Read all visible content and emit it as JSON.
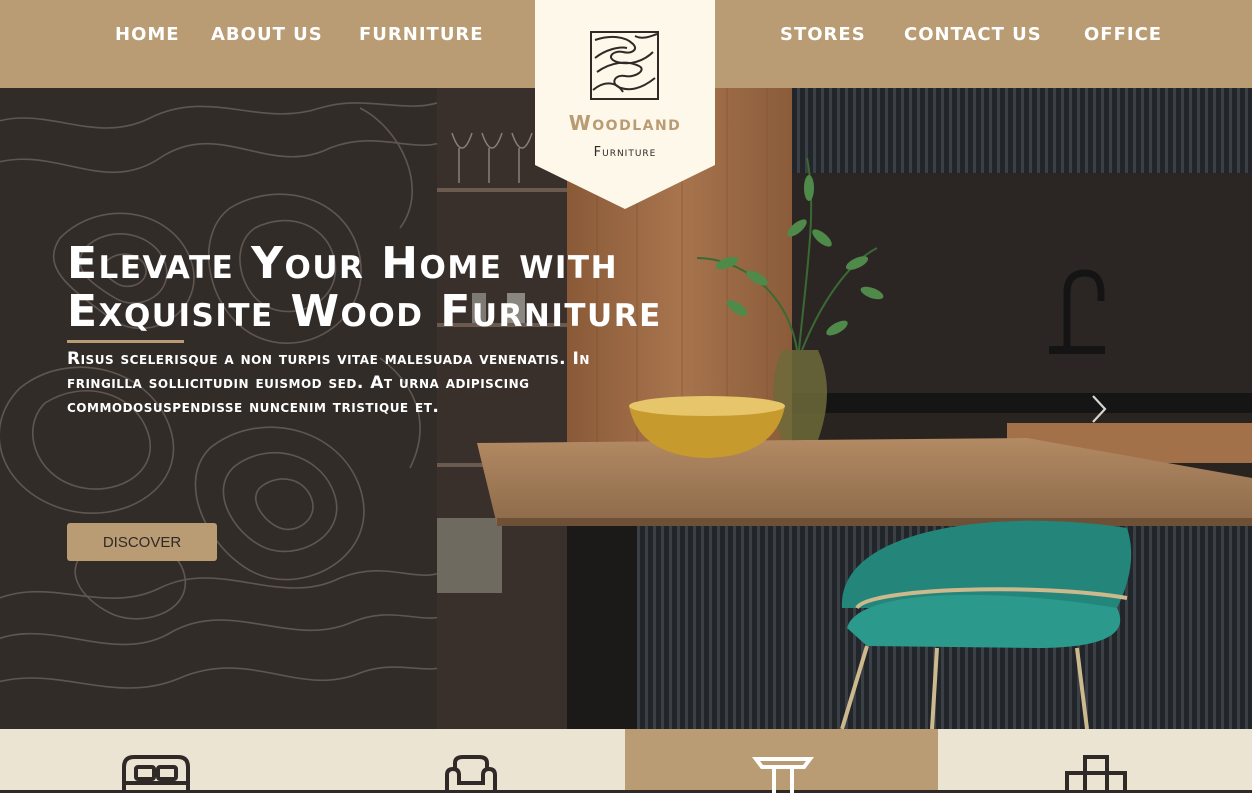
{
  "nav": {
    "left": [
      "HOME",
      "ABOUT US",
      "FURNITURE"
    ],
    "right": [
      "STORES",
      "CONTACT US",
      "OFFICE"
    ]
  },
  "logo": {
    "name": "Woodland",
    "subtitle": "Furniture"
  },
  "hero": {
    "headline": "Elevate Your Home with Exquisite Wood Furniture",
    "subtext": "Risus scelerisque a non turpis vitae malesuada venenatis. In fringilla sollicitudin euismod sed. At urna adipiscing commodosuspendisse nuncenim tristique et.",
    "cta": "DISCOVER"
  },
  "categories": [
    {
      "icon": "bed-icon",
      "active": false
    },
    {
      "icon": "armchair-icon",
      "active": false
    },
    {
      "icon": "table-icon",
      "active": true
    },
    {
      "icon": "shelf-icon",
      "active": false
    }
  ],
  "colors": {
    "brand": "#b99b74",
    "dark": "#322c29",
    "cream": "#ece4d3",
    "logo_bg": "#fdf8ea"
  }
}
